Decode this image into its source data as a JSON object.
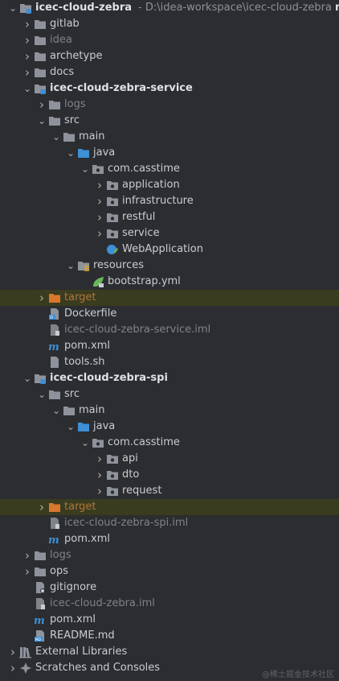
{
  "root": {
    "name": "icec-cloud-zebra",
    "path": "- D:\\idea-workspace\\icec-cloud-zebra",
    "branch": "master"
  },
  "rows": [
    {
      "depth": 1,
      "expander": "closed",
      "icon": "folder",
      "label": "gitlab",
      "style": "default",
      "name": "tree-folder-gitlab"
    },
    {
      "depth": 1,
      "expander": "closed",
      "icon": "folder",
      "label": "idea",
      "style": "muted",
      "name": "tree-folder-idea"
    },
    {
      "depth": 1,
      "expander": "closed",
      "icon": "folder",
      "label": "archetype",
      "style": "default",
      "name": "tree-folder-archetype"
    },
    {
      "depth": 1,
      "expander": "closed",
      "icon": "folder",
      "label": "docs",
      "style": "default",
      "name": "tree-folder-docs"
    },
    {
      "depth": 1,
      "expander": "open",
      "icon": "module",
      "label": "icec-cloud-zebra-service",
      "style": "module",
      "name": "tree-module-service"
    },
    {
      "depth": 2,
      "expander": "closed",
      "icon": "folder",
      "label": "logs",
      "style": "muted",
      "name": "tree-folder-logs"
    },
    {
      "depth": 2,
      "expander": "open",
      "icon": "folder",
      "label": "src",
      "style": "default",
      "name": "tree-folder-src"
    },
    {
      "depth": 3,
      "expander": "open",
      "icon": "folder",
      "label": "main",
      "style": "default",
      "name": "tree-folder-main"
    },
    {
      "depth": 4,
      "expander": "open",
      "icon": "source-folder",
      "label": "java",
      "style": "default",
      "name": "tree-folder-java"
    },
    {
      "depth": 5,
      "expander": "open",
      "icon": "package",
      "label": "com.casstime",
      "style": "default",
      "name": "tree-package-com-casstime"
    },
    {
      "depth": 6,
      "expander": "closed",
      "icon": "package",
      "label": "application",
      "style": "default",
      "name": "tree-package-application"
    },
    {
      "depth": 6,
      "expander": "closed",
      "icon": "package",
      "label": "infrastructure",
      "style": "default",
      "name": "tree-package-infrastructure"
    },
    {
      "depth": 6,
      "expander": "closed",
      "icon": "package",
      "label": "restful",
      "style": "default",
      "name": "tree-package-restful"
    },
    {
      "depth": 6,
      "expander": "closed",
      "icon": "package",
      "label": "service",
      "style": "default",
      "name": "tree-package-service"
    },
    {
      "depth": 6,
      "expander": "none",
      "icon": "spring-class",
      "label": "WebApplication",
      "style": "default",
      "name": "tree-file-webapplication"
    },
    {
      "depth": 4,
      "expander": "open",
      "icon": "resources-folder",
      "label": "resources",
      "style": "default",
      "name": "tree-folder-resources"
    },
    {
      "depth": 5,
      "expander": "none",
      "icon": "spring-yml",
      "label": "bootstrap.yml",
      "style": "default",
      "name": "tree-file-bootstrap-yml"
    },
    {
      "depth": 2,
      "expander": "closed",
      "icon": "excluded-folder",
      "label": "target",
      "style": "excluded",
      "selected": true,
      "name": "tree-folder-target"
    },
    {
      "depth": 2,
      "expander": "none",
      "icon": "docker",
      "label": "Dockerfile",
      "style": "default",
      "name": "tree-file-dockerfile"
    },
    {
      "depth": 2,
      "expander": "none",
      "icon": "iml",
      "label": "icec-cloud-zebra-service.iml",
      "style": "muted",
      "name": "tree-file-service-iml"
    },
    {
      "depth": 2,
      "expander": "none",
      "icon": "maven",
      "label": "pom.xml",
      "style": "default",
      "name": "tree-file-service-pom"
    },
    {
      "depth": 2,
      "expander": "none",
      "icon": "shell",
      "label": "tools.sh",
      "style": "default",
      "name": "tree-file-tools-sh"
    },
    {
      "depth": 1,
      "expander": "open",
      "icon": "module",
      "label": "icec-cloud-zebra-spi",
      "style": "module",
      "name": "tree-module-spi"
    },
    {
      "depth": 2,
      "expander": "open",
      "icon": "folder",
      "label": "src",
      "style": "default",
      "name": "tree-folder-spi-src"
    },
    {
      "depth": 3,
      "expander": "open",
      "icon": "folder",
      "label": "main",
      "style": "default",
      "name": "tree-folder-spi-main"
    },
    {
      "depth": 4,
      "expander": "open",
      "icon": "source-folder",
      "label": "java",
      "style": "default",
      "name": "tree-folder-spi-java"
    },
    {
      "depth": 5,
      "expander": "open",
      "icon": "package",
      "label": "com.casstime",
      "style": "default",
      "name": "tree-package-spi-com-casstime"
    },
    {
      "depth": 6,
      "expander": "closed",
      "icon": "package",
      "label": "api",
      "style": "default",
      "name": "tree-package-api"
    },
    {
      "depth": 6,
      "expander": "closed",
      "icon": "package",
      "label": "dto",
      "style": "default",
      "name": "tree-package-dto"
    },
    {
      "depth": 6,
      "expander": "closed",
      "icon": "package",
      "label": "request",
      "style": "default",
      "name": "tree-package-request"
    },
    {
      "depth": 2,
      "expander": "closed",
      "icon": "excluded-folder",
      "label": "target",
      "style": "excluded",
      "selected": true,
      "name": "tree-folder-spi-target"
    },
    {
      "depth": 2,
      "expander": "none",
      "icon": "iml",
      "label": "icec-cloud-zebra-spi.iml",
      "style": "muted",
      "name": "tree-file-spi-iml"
    },
    {
      "depth": 2,
      "expander": "none",
      "icon": "maven",
      "label": "pom.xml",
      "style": "default",
      "name": "tree-file-spi-pom"
    },
    {
      "depth": 1,
      "expander": "closed",
      "icon": "folder",
      "label": "logs",
      "style": "muted",
      "name": "tree-folder-root-logs"
    },
    {
      "depth": 1,
      "expander": "closed",
      "icon": "folder",
      "label": "ops",
      "style": "default",
      "name": "tree-folder-ops"
    },
    {
      "depth": 1,
      "expander": "none",
      "icon": "gitignore",
      "label": "gitignore",
      "style": "default",
      "name": "tree-file-gitignore"
    },
    {
      "depth": 1,
      "expander": "none",
      "icon": "iml",
      "label": "icec-cloud-zebra.iml",
      "style": "muted",
      "name": "tree-file-root-iml"
    },
    {
      "depth": 1,
      "expander": "none",
      "icon": "maven",
      "label": "pom.xml",
      "style": "default",
      "name": "tree-file-root-pom"
    },
    {
      "depth": 1,
      "expander": "none",
      "icon": "markdown",
      "label": "README.md",
      "style": "default",
      "name": "tree-file-readme"
    },
    {
      "depth": 0,
      "expander": "closed",
      "icon": "libraries",
      "label": "External Libraries",
      "style": "default",
      "name": "tree-external-libraries"
    },
    {
      "depth": 0,
      "expander": "closed",
      "icon": "scratches",
      "label": "Scratches and Consoles",
      "style": "default",
      "name": "tree-scratches-consoles"
    }
  ],
  "watermark": "@稀土掘金技术社区",
  "colors": {
    "background": "#2b2d30",
    "selected_row": "#3a3c1f",
    "folder": "#8e939b",
    "module_folder": "#8e939b",
    "source_folder": "#3d8fd6",
    "excluded_folder": "#d9772e",
    "text": "#c9ccd1",
    "muted_text": "#7f838a",
    "excluded_text": "#b0763a"
  }
}
